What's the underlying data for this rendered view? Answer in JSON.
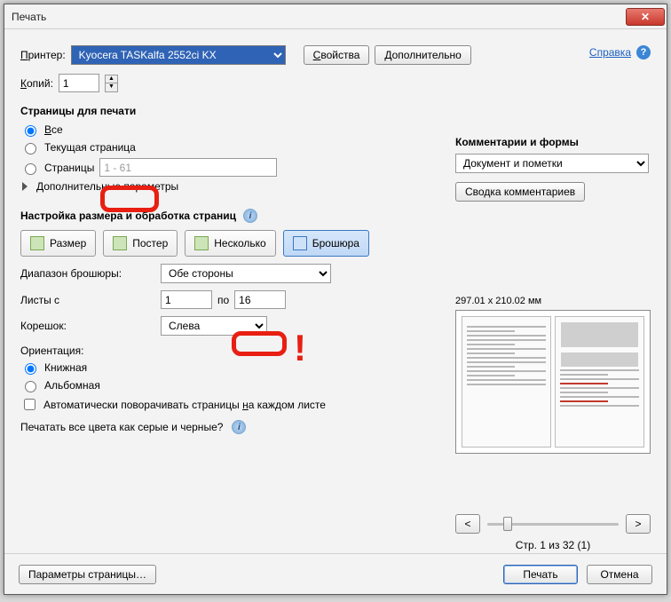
{
  "window": {
    "title": "Печать"
  },
  "help": {
    "label": "Справка"
  },
  "header": {
    "printer_label": "Принтер:",
    "printer_value": "Kyocera TASKalfa 2552ci KX",
    "properties_btn": "Свойства",
    "advanced_btn": "Дополнительно",
    "copies_label": "Копий:",
    "copies_value": "1"
  },
  "pages": {
    "title": "Страницы для печати",
    "all": "Все",
    "current": "Текущая страница",
    "range_label": "Страницы",
    "range_value": "1 - 61",
    "more_options": "Дополнительные параметры"
  },
  "sizing": {
    "title": "Настройка размера и обработка страниц",
    "size_btn": "Размер",
    "poster_btn": "Постер",
    "multiple_btn": "Несколько",
    "booklet_btn": "Брошюра"
  },
  "booklet": {
    "subset_label": "Диапазон брошюры:",
    "subset_value": "Обе стороны",
    "sheets_from_label": "Листы с",
    "sheets_from_value": "1",
    "sheets_to_label": "по",
    "sheets_to_value": "16",
    "binding_label": "Корешок:",
    "binding_value": "Слева"
  },
  "orientation": {
    "title": "Ориентация:",
    "portrait": "Книжная",
    "landscape": "Альбомная",
    "auto_rotate": "Автоматически поворачивать страницы на каждом листе",
    "grayscale_q": "Печатать все цвета как серые и черные?"
  },
  "comments": {
    "title": "Комментарии и формы",
    "value": "Документ и пометки",
    "summary_btn": "Сводка комментариев"
  },
  "preview": {
    "dimensions": "297.01 x 210.02 мм",
    "prev": "<",
    "next": ">",
    "counter": "Стр. 1 из 32 (1)"
  },
  "bottom": {
    "page_setup": "Параметры страницы…",
    "print": "Печать",
    "cancel": "Отмена"
  }
}
